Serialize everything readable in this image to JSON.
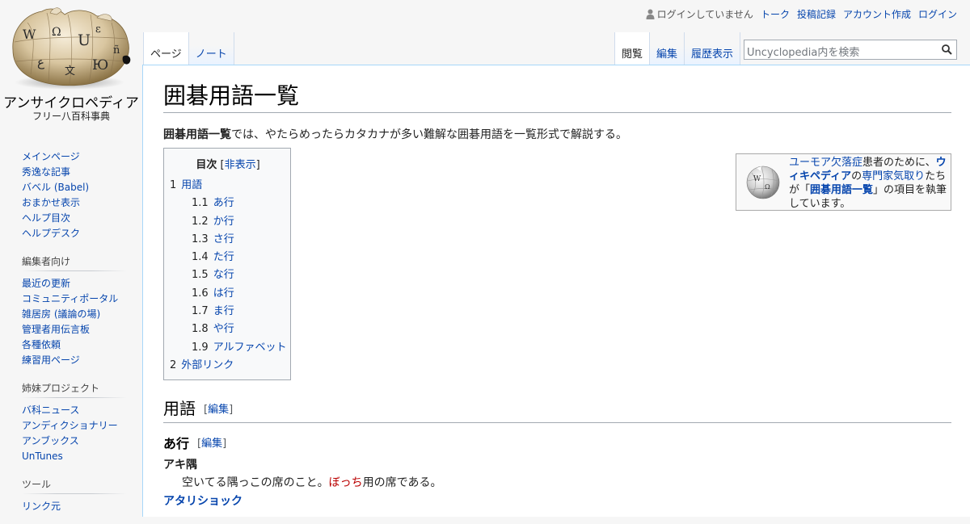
{
  "personal": {
    "status": "ログインしていません",
    "links": [
      "トーク",
      "投稿記録",
      "アカウント作成",
      "ログイン"
    ]
  },
  "logo": {
    "title": "アンサイクロペディア",
    "tagline": "フリー八百科事典"
  },
  "tabs": {
    "left": [
      {
        "label": "ページ",
        "selected": true
      },
      {
        "label": "ノート",
        "selected": false,
        "red": true
      }
    ],
    "right": [
      {
        "label": "閲覧",
        "selected": true
      },
      {
        "label": "編集",
        "selected": false
      },
      {
        "label": "履歴表示",
        "selected": false
      }
    ]
  },
  "search": {
    "placeholder": "Uncyclopedia内を検索"
  },
  "sidebar": {
    "navigation": [
      "メインページ",
      "秀逸な記事",
      "バベル (Babel)",
      "おまかせ表示",
      "ヘルプ目次",
      "ヘルプデスク"
    ],
    "editors": {
      "heading": "編集者向け",
      "items": [
        "最近の更新",
        "コミュニティポータル",
        "雑居房 (議論の場)",
        "管理者用伝言板",
        "各種依頼",
        "練習用ページ"
      ]
    },
    "sister": {
      "heading": "姉妹プロジェクト",
      "items": [
        "バ科ニュース",
        "アンディクショナリー",
        "アンブックス",
        "UnTunes"
      ]
    },
    "tools": {
      "heading": "ツール",
      "items": [
        "リンク元"
      ]
    }
  },
  "article": {
    "title": "囲碁用語一覧",
    "intro_bold": "囲碁用語一覧",
    "intro_rest": "では、やたらめったらカタカナが多い難解な囲碁用語を一覧形式で解説する。",
    "toc": {
      "title": "目次",
      "toggle_open": "[",
      "toggle": "非表示",
      "toggle_close": "]",
      "items": [
        {
          "num": "1",
          "label": "用語",
          "level": 1
        },
        {
          "num": "1.1",
          "label": "あ行",
          "level": 2
        },
        {
          "num": "1.2",
          "label": "か行",
          "level": 2
        },
        {
          "num": "1.3",
          "label": "さ行",
          "level": 2
        },
        {
          "num": "1.4",
          "label": "た行",
          "level": 2
        },
        {
          "num": "1.5",
          "label": "な行",
          "level": 2
        },
        {
          "num": "1.6",
          "label": "は行",
          "level": 2
        },
        {
          "num": "1.7",
          "label": "ま行",
          "level": 2
        },
        {
          "num": "1.8",
          "label": "や行",
          "level": 2
        },
        {
          "num": "1.9",
          "label": "アルファベット",
          "level": 2
        },
        {
          "num": "2",
          "label": "外部リンク",
          "level": 1
        }
      ]
    },
    "ambox": {
      "link1": "ユーモア欠落症",
      "text1": "患者のために、",
      "link2": "ウィキペディア",
      "text2": "の",
      "link3": "専門家気取り",
      "text3": "たちが「",
      "link4": "囲碁用語一覧",
      "text4": "」の項目を執筆しています。"
    },
    "section1": {
      "title": "用語",
      "edit": "編集"
    },
    "subsection1": {
      "title": "あ行",
      "edit": "編集"
    },
    "entries": [
      {
        "term": "アキ隅",
        "desc_before": "空いてる隅っこの席のこと。",
        "desc_link": "ぼっち",
        "desc_after": "用の席である。"
      },
      {
        "term": "アタリショック"
      }
    ]
  }
}
